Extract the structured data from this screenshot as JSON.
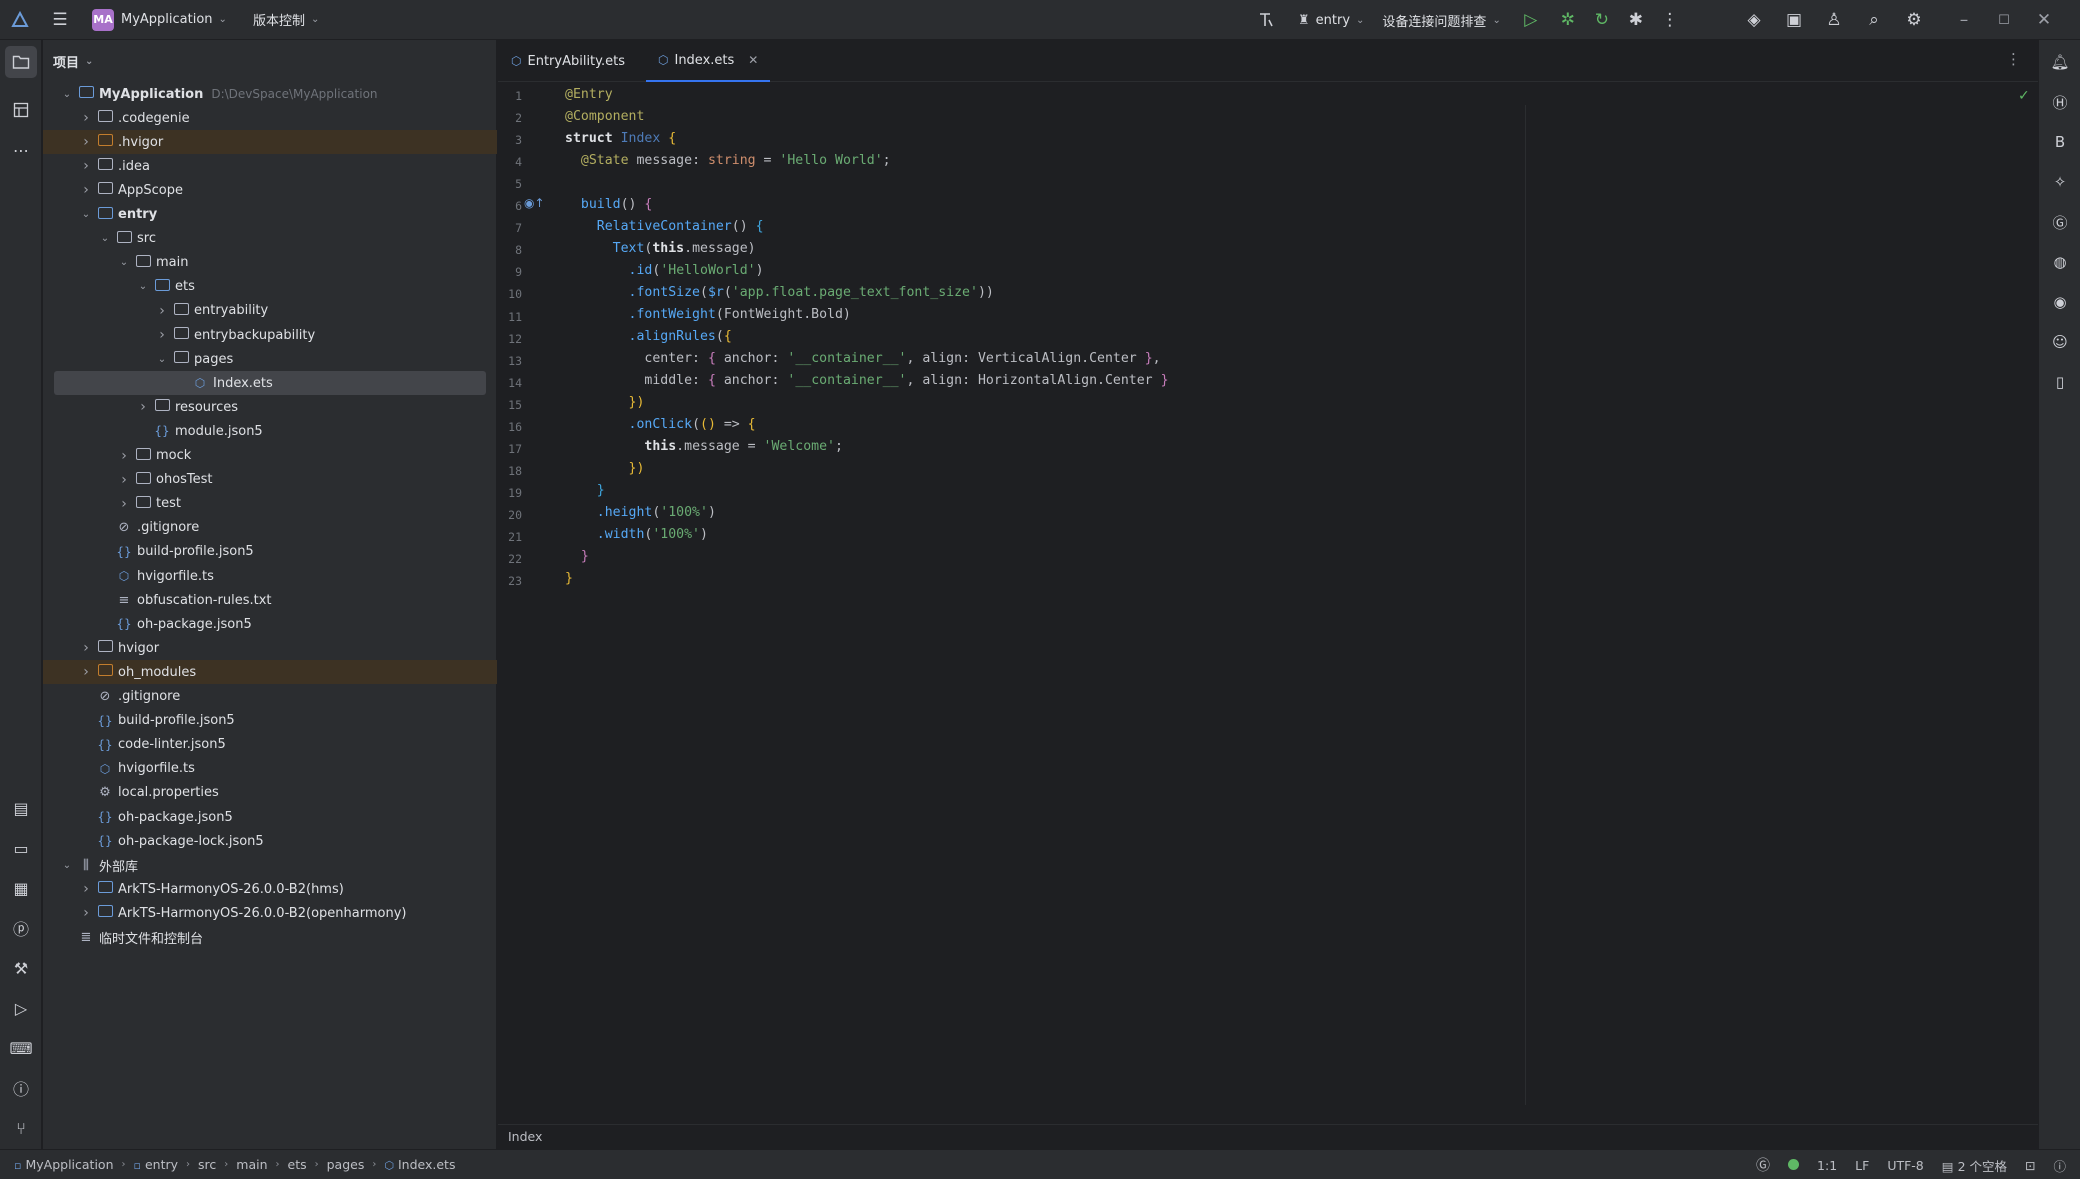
{
  "titlebar": {
    "project_badge": "MA",
    "project_name": "MyApplication",
    "vcs_label": "版本控制",
    "run_config": "entry",
    "device_label": "设备连接问题排查"
  },
  "project_panel": {
    "title": "项目",
    "root_path": "D:\\DevSpace\\MyApplication",
    "tree": [
      {
        "label": "MyApplication",
        "depth": 0,
        "arrow": "open",
        "icon": "module",
        "bold": true
      },
      {
        "label": ".codegenie",
        "depth": 1,
        "arrow": "closed",
        "icon": "folder"
      },
      {
        "label": ".hvigor",
        "depth": 1,
        "arrow": "closed",
        "icon": "folder-orange",
        "excluded": true
      },
      {
        "label": ".idea",
        "depth": 1,
        "arrow": "closed",
        "icon": "folder"
      },
      {
        "label": "AppScope",
        "depth": 1,
        "arrow": "closed",
        "icon": "folder"
      },
      {
        "label": "entry",
        "depth": 1,
        "arrow": "open",
        "icon": "module",
        "bold": true
      },
      {
        "label": "src",
        "depth": 2,
        "arrow": "open",
        "icon": "folder"
      },
      {
        "label": "main",
        "depth": 3,
        "arrow": "open",
        "icon": "folder"
      },
      {
        "label": "ets",
        "depth": 4,
        "arrow": "open",
        "icon": "module"
      },
      {
        "label": "entryability",
        "depth": 5,
        "arrow": "closed",
        "icon": "folder"
      },
      {
        "label": "entrybackupability",
        "depth": 5,
        "arrow": "closed",
        "icon": "folder"
      },
      {
        "label": "pages",
        "depth": 5,
        "arrow": "open",
        "icon": "folder"
      },
      {
        "label": "Index.ets",
        "depth": 6,
        "arrow": "none",
        "icon": "ts",
        "selected": true
      },
      {
        "label": "resources",
        "depth": 4,
        "arrow": "closed",
        "icon": "folder"
      },
      {
        "label": "module.json5",
        "depth": 4,
        "arrow": "none",
        "icon": "json"
      },
      {
        "label": "mock",
        "depth": 3,
        "arrow": "closed",
        "icon": "folder"
      },
      {
        "label": "ohosTest",
        "depth": 3,
        "arrow": "closed",
        "icon": "folder"
      },
      {
        "label": "test",
        "depth": 3,
        "arrow": "closed",
        "icon": "folder"
      },
      {
        "label": ".gitignore",
        "depth": 2,
        "arrow": "none",
        "icon": "ignore"
      },
      {
        "label": "build-profile.json5",
        "depth": 2,
        "arrow": "none",
        "icon": "json"
      },
      {
        "label": "hvigorfile.ts",
        "depth": 2,
        "arrow": "none",
        "icon": "ts"
      },
      {
        "label": "obfuscation-rules.txt",
        "depth": 2,
        "arrow": "none",
        "icon": "txt"
      },
      {
        "label": "oh-package.json5",
        "depth": 2,
        "arrow": "none",
        "icon": "json"
      },
      {
        "label": "hvigor",
        "depth": 1,
        "arrow": "closed",
        "icon": "folder"
      },
      {
        "label": "oh_modules",
        "depth": 1,
        "arrow": "closed",
        "icon": "folder-orange",
        "excluded": true
      },
      {
        "label": ".gitignore",
        "depth": 1,
        "arrow": "none",
        "icon": "ignore"
      },
      {
        "label": "build-profile.json5",
        "depth": 1,
        "arrow": "none",
        "icon": "json"
      },
      {
        "label": "code-linter.json5",
        "depth": 1,
        "arrow": "none",
        "icon": "json"
      },
      {
        "label": "hvigorfile.ts",
        "depth": 1,
        "arrow": "none",
        "icon": "ts"
      },
      {
        "label": "local.properties",
        "depth": 1,
        "arrow": "none",
        "icon": "gear"
      },
      {
        "label": "oh-package.json5",
        "depth": 1,
        "arrow": "none",
        "icon": "json"
      },
      {
        "label": "oh-package-lock.json5",
        "depth": 1,
        "arrow": "none",
        "icon": "json"
      },
      {
        "label": "外部库",
        "depth": 0,
        "arrow": "open",
        "icon": "lib"
      },
      {
        "label": "ArkTS-HarmonyOS-26.0.0-B2(hms)",
        "depth": 1,
        "arrow": "closed",
        "icon": "module"
      },
      {
        "label": "ArkTS-HarmonyOS-26.0.0-B2(openharmony)",
        "depth": 1,
        "arrow": "closed",
        "icon": "module"
      },
      {
        "label": "临时文件和控制台",
        "depth": 0,
        "arrow": "none",
        "icon": "console"
      }
    ]
  },
  "editor": {
    "tabs": [
      {
        "label": "EntryAbility.ets",
        "active": false
      },
      {
        "label": "Index.ets",
        "active": true
      }
    ],
    "line_numbers": [
      "1",
      "2",
      "3",
      "4",
      "5",
      "6",
      "7",
      "8",
      "9",
      "10",
      "11",
      "12",
      "13",
      "14",
      "15",
      "16",
      "17",
      "18",
      "19",
      "20",
      "21",
      "22",
      "23"
    ],
    "code": {
      "l1": "@Entry",
      "l2": "@Component",
      "l3_kw": "struct",
      "l3_name": "Index",
      "l4_dec": "@State",
      "l4_var": "message",
      "l4_type": "string",
      "l4_str": "'Hello World'",
      "l6_fn": "build",
      "l7_fn": "RelativeContainer",
      "l8_fn": "Text",
      "l8_this": "this",
      "l8_prop": "message",
      "l9_fn": ".id",
      "l9_str": "'HelloWorld'",
      "l10_fn": ".fontSize",
      "l10_r": "$r",
      "l10_str": "'app.float.page_text_font_size'",
      "l11_fn": ".fontWeight",
      "l11_arg": "FontWeight.Bold",
      "l12_fn": ".alignRules",
      "l13_key": "center",
      "l13_str": "'__container__'",
      "l13_val": "VerticalAlign.Center",
      "l14_key": "middle",
      "l14_str": "'__container__'",
      "l14_val": "HorizontalAlign.Center",
      "l16_fn": ".onClick",
      "l17_this": "this",
      "l17_prop": "message",
      "l17_str": "'Welcome'",
      "l20_fn": ".height",
      "l20_str": "'100%'",
      "l21_fn": ".width",
      "l21_str": "'100%'",
      "anchor_key": "anchor",
      "align_key": "align"
    },
    "footer_label": "Index"
  },
  "statusbar": {
    "breadcrumb": [
      "MyApplication",
      "entry",
      "src",
      "main",
      "ets",
      "pages",
      "Index.ets"
    ],
    "position": "1:1",
    "line_sep": "LF",
    "encoding": "UTF-8",
    "indent": "2 个空格"
  },
  "colors": {
    "accent": "#3574f0",
    "background": "#1e1f22",
    "panel": "#2b2d30",
    "status_ok": "#5fb865"
  }
}
